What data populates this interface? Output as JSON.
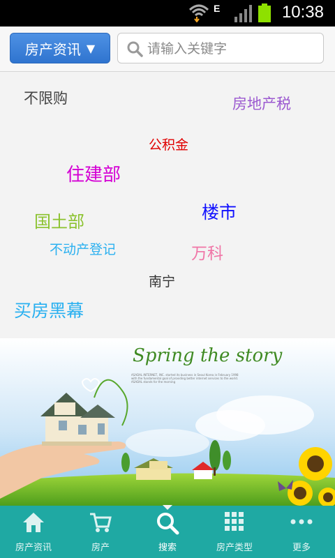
{
  "status_bar": {
    "time": "10:38",
    "network": "E"
  },
  "header": {
    "category_button": "房产资讯",
    "search_placeholder": "请输入关键字"
  },
  "tags": [
    {
      "text": "不限购",
      "color": "#444444"
    },
    {
      "text": "房地产税",
      "color": "#9b59d0"
    },
    {
      "text": "公积金",
      "color": "#e00000"
    },
    {
      "text": "住建部",
      "color": "#d400d4"
    },
    {
      "text": "楼市",
      "color": "#1010ff"
    },
    {
      "text": "国土部",
      "color": "#8bc22e"
    },
    {
      "text": "不动产登记",
      "color": "#2ab0f0"
    },
    {
      "text": "万科",
      "color": "#f074a6"
    },
    {
      "text": "南宁",
      "color": "#333333"
    },
    {
      "text": "买房黑幕",
      "color": "#2ab0f0"
    }
  ],
  "banner": {
    "headline": "Spring the story",
    "fine_print": "ASADAL INTERNET, INC. started its business in Seoul Korea in February 1998 with the fundamental goal of providing better internet services to the world. ASADAL stands for the morning"
  },
  "bottom_nav": [
    {
      "label": "房产资讯",
      "icon": "home-icon"
    },
    {
      "label": "房产",
      "icon": "cart-icon"
    },
    {
      "label": "搜索",
      "icon": "search-icon"
    },
    {
      "label": "房产类型",
      "icon": "grid-icon"
    },
    {
      "label": "更多",
      "icon": "more-icon"
    }
  ],
  "colors": {
    "accent": "#1fa9a3",
    "button": "#3a7fd8"
  }
}
